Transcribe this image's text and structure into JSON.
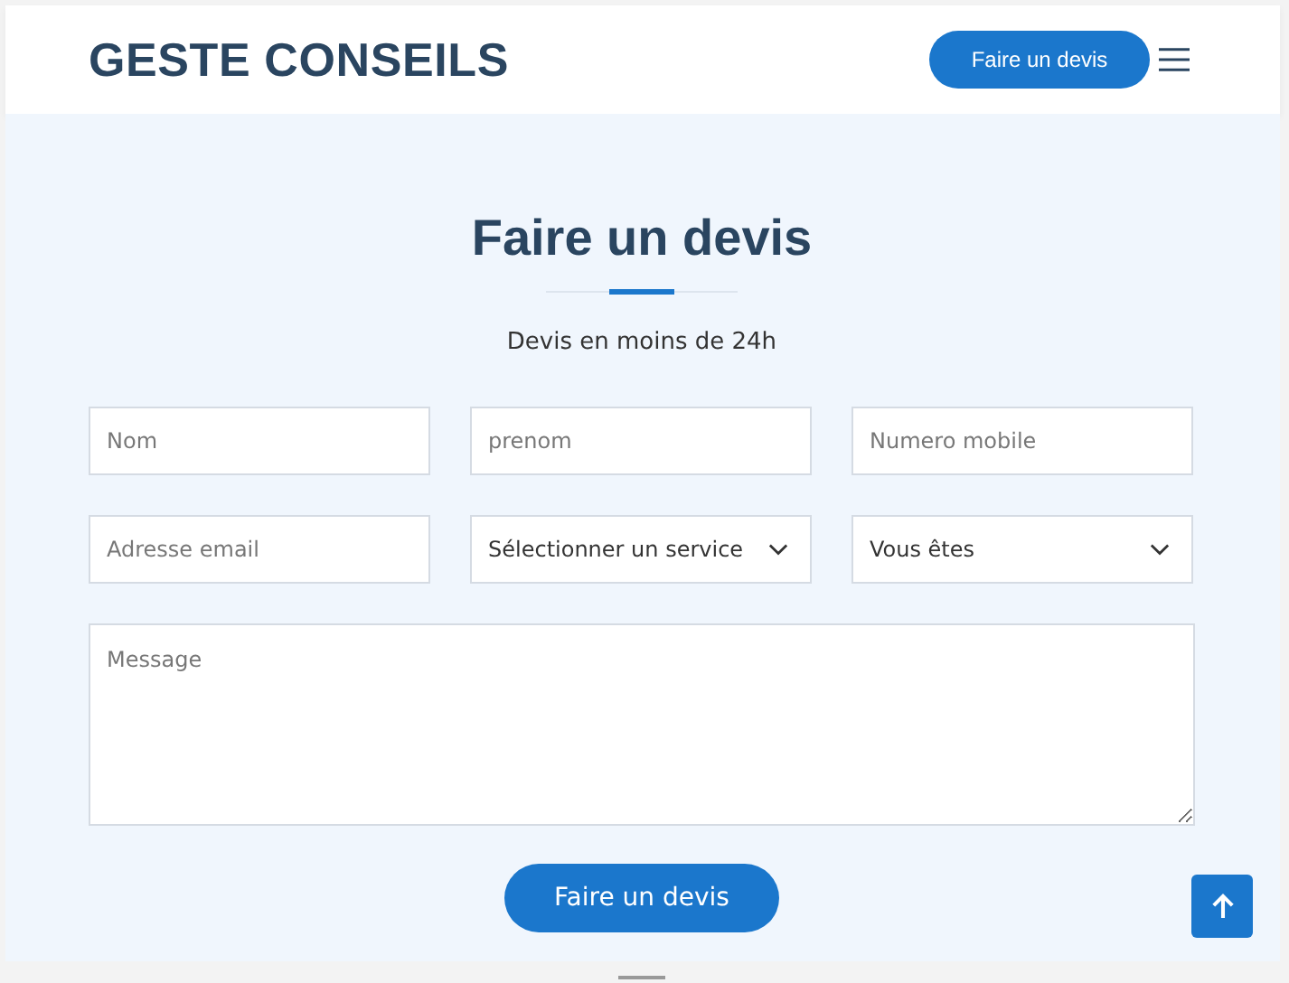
{
  "header": {
    "logo": "GESTE CONSEILS",
    "cta_button": "Faire un devis"
  },
  "form_section": {
    "title": "Faire un devis",
    "subtitle": "Devis en moins de 24h",
    "fields": [
      {
        "kind": "input",
        "placeholder": "Nom"
      },
      {
        "kind": "input",
        "placeholder": "prenom"
      },
      {
        "kind": "input",
        "placeholder": "Numero mobile"
      },
      {
        "kind": "input",
        "placeholder": "Adresse email"
      },
      {
        "kind": "select",
        "value": "Sélectionner un service"
      },
      {
        "kind": "select",
        "value": "Vous êtes"
      }
    ],
    "message": {
      "placeholder": "Message"
    },
    "submit_button": "Faire un devis"
  }
}
